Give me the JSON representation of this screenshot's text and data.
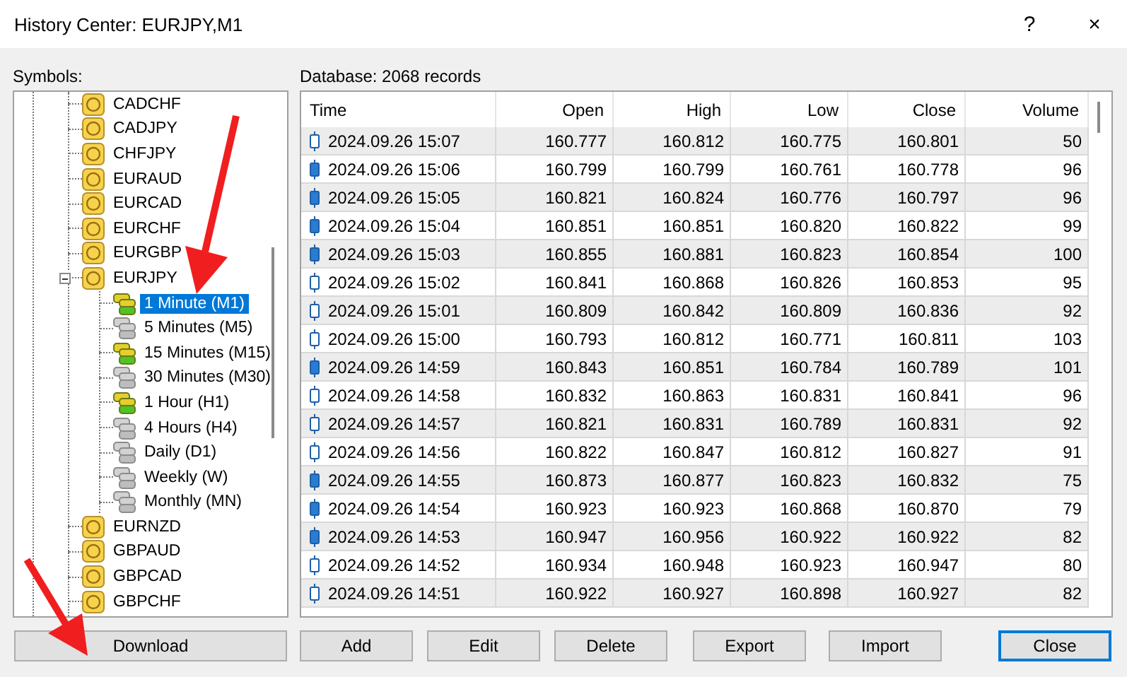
{
  "window": {
    "title": "History Center: EURJPY,M1",
    "controls": [
      "?",
      "×"
    ]
  },
  "symbols": {
    "label": "Symbols:",
    "items": [
      {
        "name": "CADCHF",
        "selected": false
      },
      {
        "name": "CADJPY",
        "selected": false
      },
      {
        "name": "CHFJPY",
        "selected": false
      },
      {
        "name": "EURAUD",
        "selected": false
      },
      {
        "name": "EURCAD",
        "selected": false
      },
      {
        "name": "EURCHF",
        "selected": false
      },
      {
        "name": "EURGBP",
        "selected": false
      },
      {
        "name": "EURJPY",
        "selected": false,
        "expanded": true,
        "children": [
          {
            "name": "1 Minute (M1)",
            "has_data": true,
            "selected": true
          },
          {
            "name": "5 Minutes (M5)",
            "has_data": false,
            "selected": false
          },
          {
            "name": "15 Minutes (M15)",
            "has_data": true,
            "selected": false
          },
          {
            "name": "30 Minutes (M30)",
            "has_data": false,
            "selected": false
          },
          {
            "name": "1 Hour (H1)",
            "has_data": true,
            "selected": false
          },
          {
            "name": "4 Hours (H4)",
            "has_data": false,
            "selected": false
          },
          {
            "name": "Daily (D1)",
            "has_data": false,
            "selected": false
          },
          {
            "name": "Weekly (W)",
            "has_data": false,
            "selected": false
          },
          {
            "name": "Monthly (MN)",
            "has_data": false,
            "selected": false
          }
        ]
      },
      {
        "name": "EURNZD",
        "selected": false
      },
      {
        "name": "GBPAUD",
        "selected": false
      },
      {
        "name": "GBPCAD",
        "selected": false
      },
      {
        "name": "GBPCHF",
        "selected": false
      }
    ]
  },
  "database": {
    "label": "Database: 2068 records",
    "columns": [
      "Time",
      "Open",
      "High",
      "Low",
      "Close",
      "Volume"
    ],
    "rows": [
      {
        "kind": "bull",
        "cells": [
          "2024.09.26 15:07",
          "160.777",
          "160.812",
          "160.775",
          "160.801",
          "50"
        ]
      },
      {
        "kind": "bear",
        "cells": [
          "2024.09.26 15:06",
          "160.799",
          "160.799",
          "160.761",
          "160.778",
          "96"
        ]
      },
      {
        "kind": "bear",
        "cells": [
          "2024.09.26 15:05",
          "160.821",
          "160.824",
          "160.776",
          "160.797",
          "96"
        ]
      },
      {
        "kind": "bear",
        "cells": [
          "2024.09.26 15:04",
          "160.851",
          "160.851",
          "160.820",
          "160.822",
          "99"
        ]
      },
      {
        "kind": "bear",
        "cells": [
          "2024.09.26 15:03",
          "160.855",
          "160.881",
          "160.823",
          "160.854",
          "100"
        ]
      },
      {
        "kind": "bull",
        "cells": [
          "2024.09.26 15:02",
          "160.841",
          "160.868",
          "160.826",
          "160.853",
          "95"
        ]
      },
      {
        "kind": "bull",
        "cells": [
          "2024.09.26 15:01",
          "160.809",
          "160.842",
          "160.809",
          "160.836",
          "92"
        ]
      },
      {
        "kind": "bull",
        "cells": [
          "2024.09.26 15:00",
          "160.793",
          "160.812",
          "160.771",
          "160.811",
          "103"
        ]
      },
      {
        "kind": "bear",
        "cells": [
          "2024.09.26 14:59",
          "160.843",
          "160.851",
          "160.784",
          "160.789",
          "101"
        ]
      },
      {
        "kind": "bull",
        "cells": [
          "2024.09.26 14:58",
          "160.832",
          "160.863",
          "160.831",
          "160.841",
          "96"
        ]
      },
      {
        "kind": "bull",
        "cells": [
          "2024.09.26 14:57",
          "160.821",
          "160.831",
          "160.789",
          "160.831",
          "92"
        ]
      },
      {
        "kind": "bull",
        "cells": [
          "2024.09.26 14:56",
          "160.822",
          "160.847",
          "160.812",
          "160.827",
          "91"
        ]
      },
      {
        "kind": "bear",
        "cells": [
          "2024.09.26 14:55",
          "160.873",
          "160.877",
          "160.823",
          "160.832",
          "75"
        ]
      },
      {
        "kind": "bear",
        "cells": [
          "2024.09.26 14:54",
          "160.923",
          "160.923",
          "160.868",
          "160.870",
          "79"
        ]
      },
      {
        "kind": "bear",
        "cells": [
          "2024.09.26 14:53",
          "160.947",
          "160.956",
          "160.922",
          "160.922",
          "82"
        ]
      },
      {
        "kind": "bull",
        "cells": [
          "2024.09.26 14:52",
          "160.934",
          "160.948",
          "160.923",
          "160.947",
          "80"
        ]
      },
      {
        "kind": "bull",
        "cells": [
          "2024.09.26 14:51",
          "160.922",
          "160.927",
          "160.898",
          "160.927",
          "82"
        ]
      }
    ]
  },
  "buttons": [
    {
      "label": "Download",
      "default": false
    },
    {
      "label": "Add",
      "default": false
    },
    {
      "label": "Edit",
      "default": false
    },
    {
      "label": "Delete",
      "default": false
    },
    {
      "label": "Export",
      "default": false
    },
    {
      "label": "Import",
      "default": false
    },
    {
      "label": "Close",
      "default": true
    }
  ]
}
